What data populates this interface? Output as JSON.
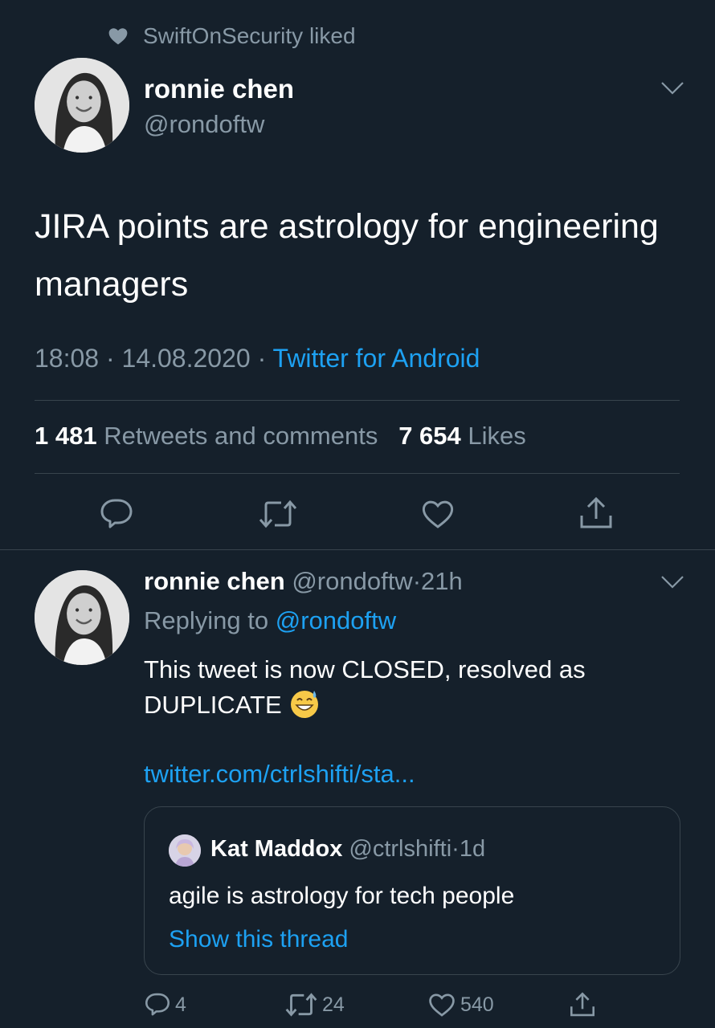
{
  "social_context": {
    "text": "SwiftOnSecurity liked",
    "icon": "heart-icon"
  },
  "main_tweet": {
    "name": "ronnie chen",
    "handle": "@rondoftw",
    "text": "JIRA points are astrology for engineering managers",
    "time": "18:08",
    "separator": "·",
    "date": "14.08.2020",
    "source": "Twitter for Android",
    "retweets_count": "1 481",
    "retweets_label": "Retweets and comments",
    "likes_count": "7 654",
    "likes_label": "Likes",
    "actions": [
      "reply-icon",
      "retweet-icon",
      "like-icon",
      "share-icon"
    ]
  },
  "reply_tweet": {
    "name": "ronnie chen",
    "handle": "@rondoftw",
    "separator": "·",
    "time": "21h",
    "replying_prefix": "Replying to",
    "replying_to": "@rondoftw",
    "text": "This tweet is now CLOSED, resolved as DUPLICATE",
    "emoji": "grinning-sweat-emoji",
    "link": "twitter.com/ctrlshifti/sta...",
    "quote": {
      "name": "Kat Maddox",
      "handle": "@ctrlshifti",
      "separator": "·",
      "time": "1d",
      "text": "agile is astrology for tech people",
      "thread_link": "Show this thread"
    },
    "reply_count": "4",
    "retweet_count": "24",
    "like_count": "540"
  },
  "colors": {
    "background": "#15202b",
    "text": "#ffffff",
    "secondary": "#8899a6",
    "accent": "#1da1f2",
    "border": "#38444d"
  }
}
